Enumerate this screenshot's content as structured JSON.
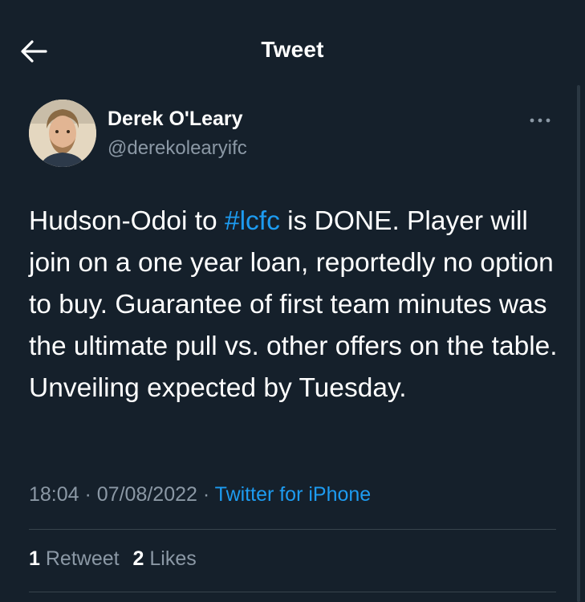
{
  "header": {
    "title": "Tweet",
    "back_icon": "back-arrow-icon"
  },
  "author": {
    "name": "Derek O'Leary",
    "handle": "@derekolearyifc"
  },
  "tweet": {
    "text_before": "Hudson-Odoi to ",
    "hashtag": "#lcfc",
    "text_after": " is DONE. Player will join on a one year loan, reportedly no option to buy. Guarantee of first team minutes was the ultimate pull vs. other offers on the table. Unveiling expected by Tuesday."
  },
  "meta": {
    "time": "18:04",
    "separator": " · ",
    "date": "07/08/2022",
    "separator2": " · ",
    "source": "Twitter for iPhone"
  },
  "stats": {
    "retweets_count": "1",
    "retweets_label": "Retweet",
    "likes_count": "2",
    "likes_label": "Likes"
  },
  "colors": {
    "background": "#15202b",
    "accent": "#1d9bf0",
    "secondary_text": "#8b98a5",
    "divider": "#38444d"
  }
}
